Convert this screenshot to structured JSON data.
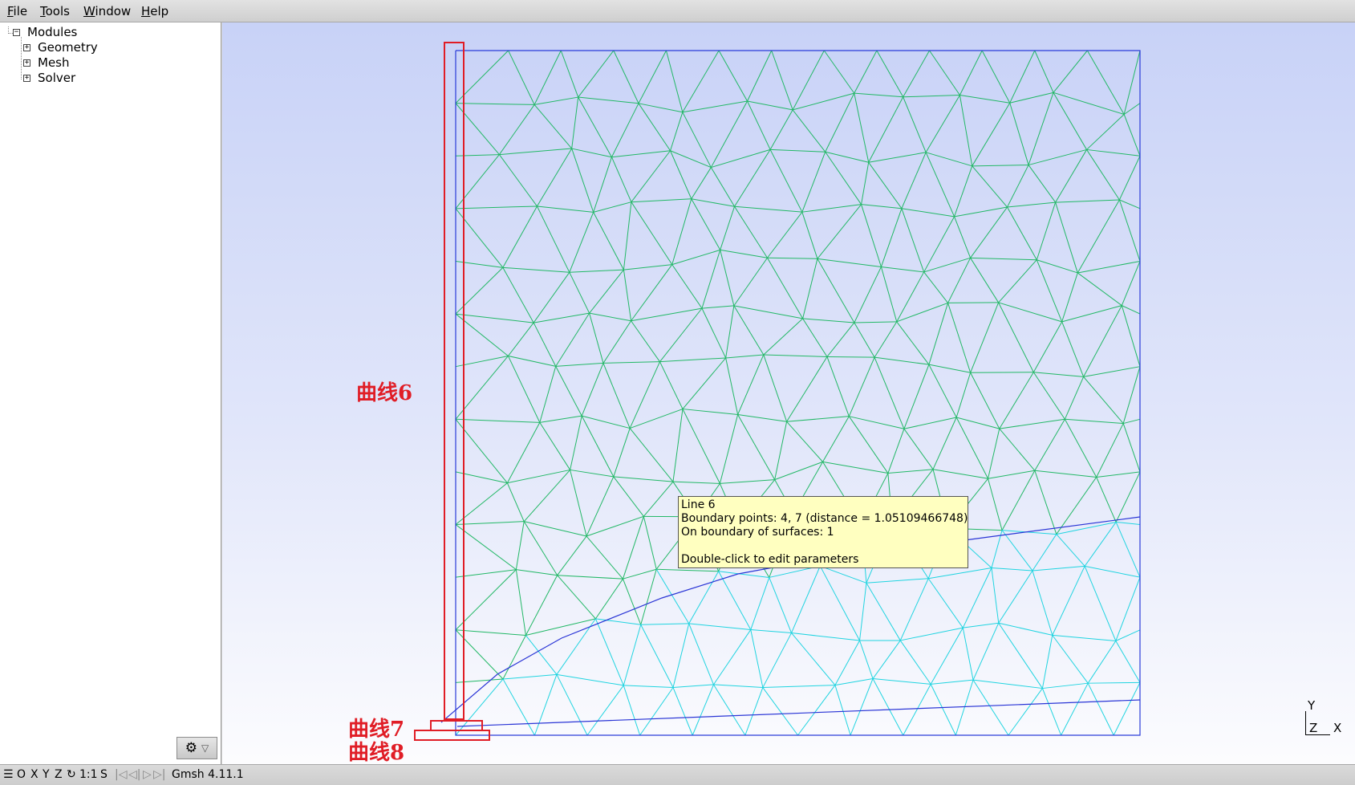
{
  "menu": {
    "file": {
      "label": "File",
      "u": "F",
      "rest": "ile"
    },
    "tools": {
      "label": "Tools",
      "u": "T",
      "rest": "ools"
    },
    "window": {
      "label": "Window",
      "u": "W",
      "rest": "indow"
    },
    "help": {
      "label": "Help",
      "u": "H",
      "rest": "elp"
    }
  },
  "tree": {
    "root": "Modules",
    "items": [
      "Geometry",
      "Mesh",
      "Solver"
    ]
  },
  "tooltip": {
    "line1": "Line 6",
    "line2": "Boundary points: 4, 7 (distance = 1.05109466748)",
    "line3": "On boundary of surfaces: 1",
    "line4": "Double-click to edit parameters"
  },
  "annotations": {
    "curve6": "曲线6",
    "curve7": "曲线7",
    "curve8": "曲线8",
    "color": "#e01d26"
  },
  "axes": {
    "y": "Y",
    "z": "Z",
    "x": "X"
  },
  "status": {
    "menu_glyph": "☰",
    "o": "O",
    "x": "X",
    "y": "Y",
    "z": "Z",
    "rotate_glyph": "↻",
    "scale": "1:1",
    "s": "S",
    "first": "|◁",
    "prev": "◁|",
    "next": "▷",
    "last": "▷|",
    "version": "Gmsh 4.11.1"
  },
  "mesh_colors": {
    "upper": "#22b866",
    "lower": "#20d4e0",
    "curve": "#2a35d6",
    "boundary": "#2b3cd9"
  }
}
